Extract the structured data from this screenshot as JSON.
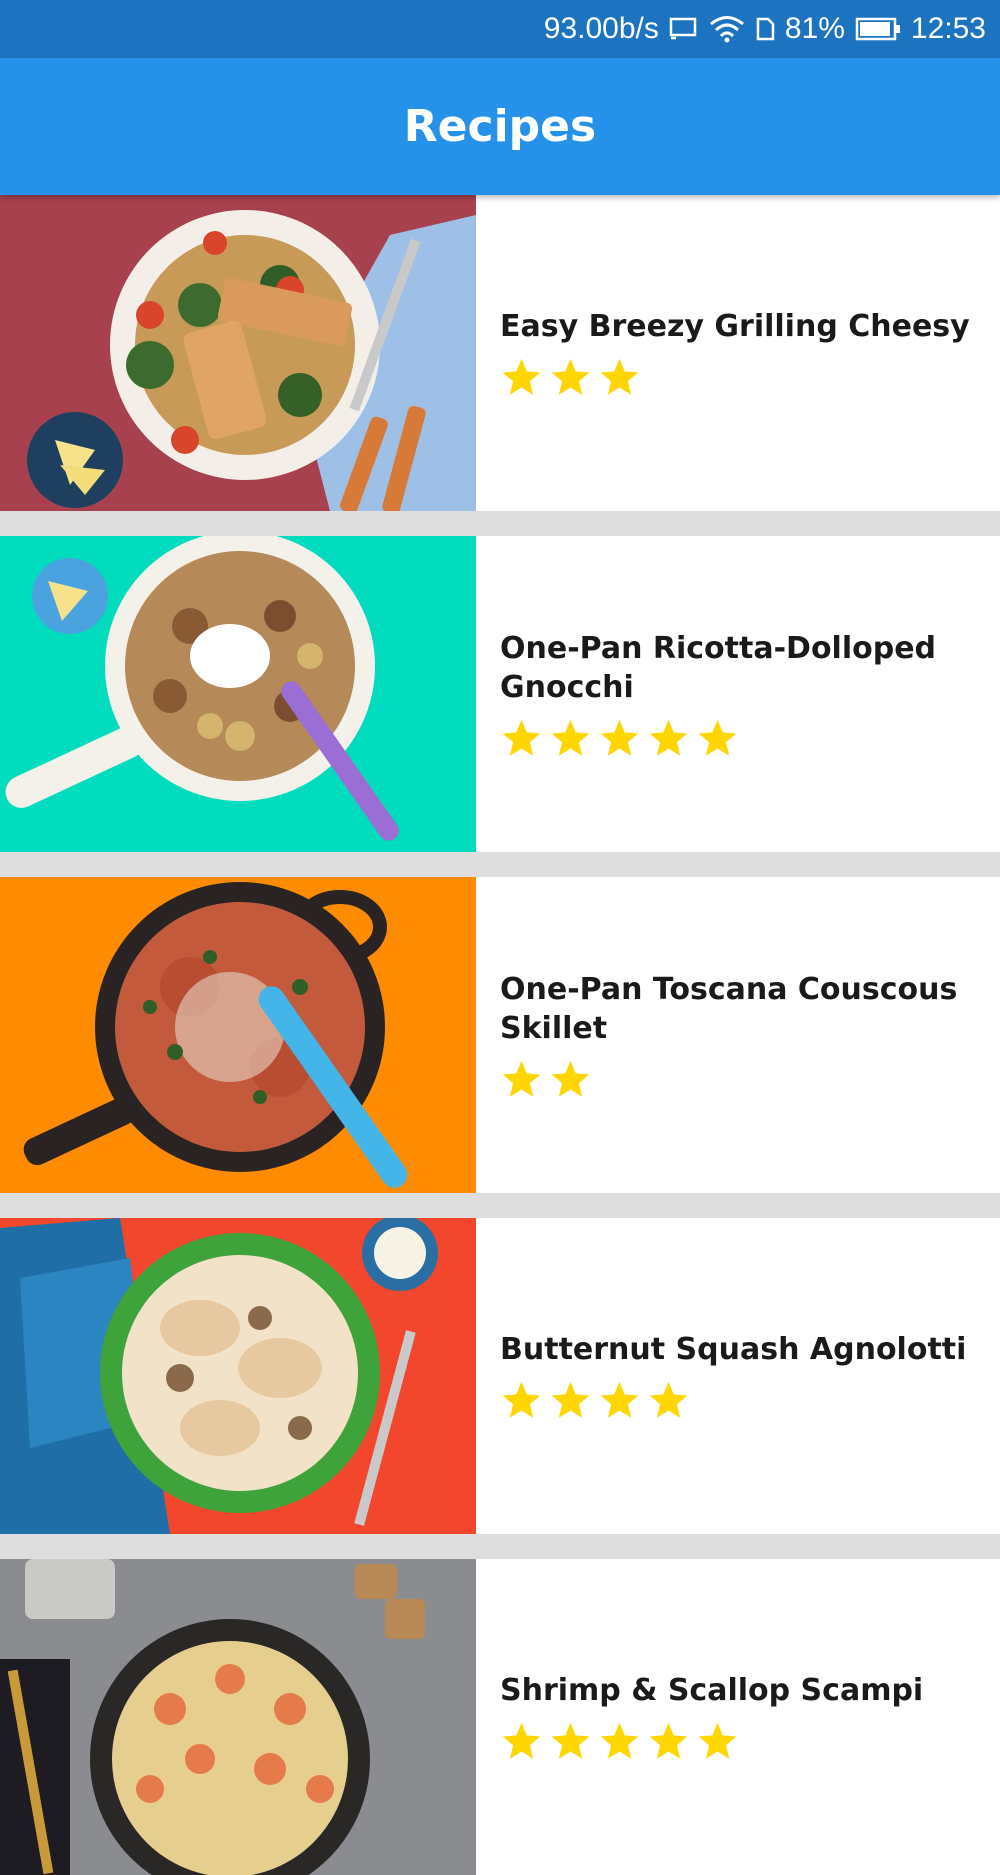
{
  "status_bar": {
    "network_speed": "93.00b/s",
    "battery": "81%",
    "time": "12:53"
  },
  "app_bar": {
    "title": "Recipes"
  },
  "colors": {
    "status_bar": "#1c73bf",
    "app_bar": "#2591e8",
    "star": "#ffd600",
    "separator": "#dedede"
  },
  "recipes": [
    {
      "name": "Easy Breezy Grilling Cheesy",
      "rating": 3,
      "image": "grilled-halloumi-plate"
    },
    {
      "name": "One-Pan Ricotta-Dolloped Gnocchi",
      "rating": 5,
      "image": "gnocchi-pan"
    },
    {
      "name": "One-Pan Toscana Couscous Skillet",
      "rating": 2,
      "image": "couscous-skillet"
    },
    {
      "name": "Butternut Squash Agnolotti",
      "rating": 4,
      "image": "agnolotti-plate"
    },
    {
      "name": "Shrimp & Scallop Scampi",
      "rating": 5,
      "image": "scampi-pasta"
    }
  ]
}
